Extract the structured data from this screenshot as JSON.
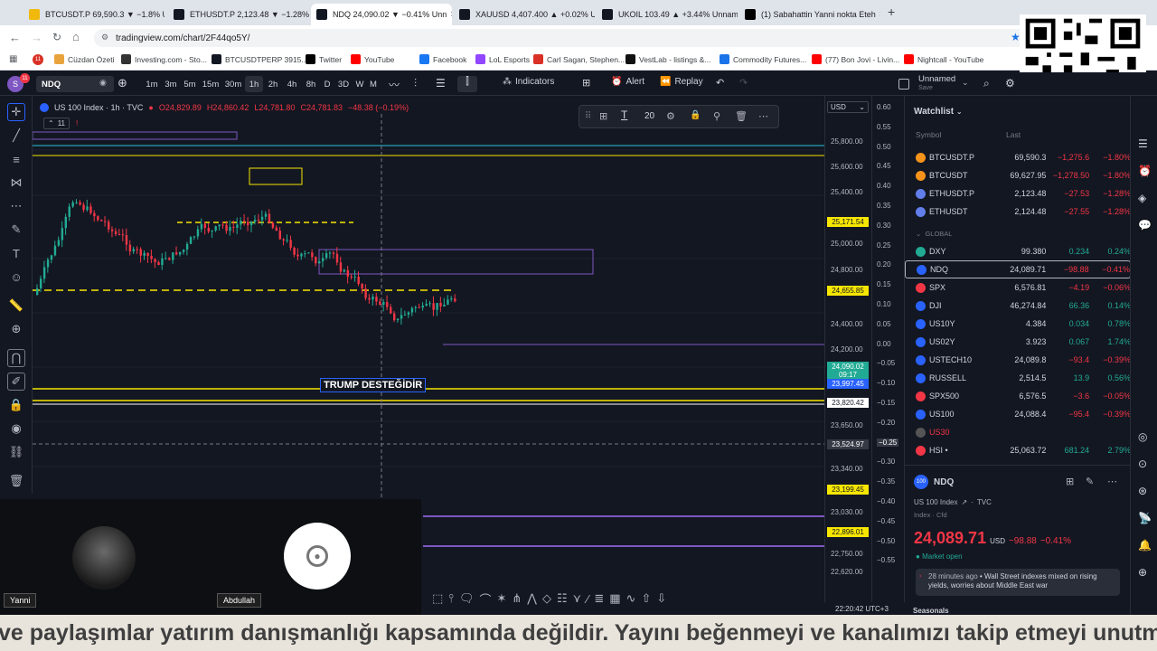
{
  "tabs": [
    {
      "label": "BTCUSDT.P 69,590.3 ▼ −1.8% U",
      "color": "#f0b90b"
    },
    {
      "label": "ETHUSDT.P 2,123.48 ▼ −1.28% U",
      "color": "#131722"
    },
    {
      "label": "NDQ 24,090.02 ▼ −0.41% Unn",
      "color": "#131722",
      "active": true
    },
    {
      "label": "XAUUSD 4,407.400 ▲ +0.02% U",
      "color": "#131722"
    },
    {
      "label": "UKOIL 103.49 ▲ +3.44% Unnam",
      "color": "#131722"
    },
    {
      "label": "(1) Sabahattin Yanni nokta Eteh",
      "color": "#000000"
    }
  ],
  "address": "tradingview.com/chart/2F44qo5Y/",
  "bookmarks": [
    {
      "label": "Cüzdan Özeti",
      "color": "#e8a33d"
    },
    {
      "label": "Investing.com - Sto...",
      "color": "#333333"
    },
    {
      "label": "BTCUSDTPERP 3915...",
      "color": "#131722"
    },
    {
      "label": "Twitter",
      "color": "#000000"
    },
    {
      "label": "YouTube",
      "color": "#ff0000"
    },
    {
      "label": "Facebook",
      "color": "#1877f2"
    },
    {
      "label": "LoL Esports",
      "color": "#9146ff"
    },
    {
      "label": "Carl Sagan, Stephen...",
      "color": "#d93025"
    },
    {
      "label": "VestLab - listings &...",
      "color": "#111111"
    },
    {
      "label": "Commodity Futures...",
      "color": "#1a73e8"
    },
    {
      "label": "(77) Bon Jovi - Livin...",
      "color": "#ff0000"
    },
    {
      "label": "Nightcall - YouTube",
      "color": "#ff0000"
    }
  ],
  "toolbar": {
    "symbol": "NDQ",
    "intervals": [
      "1m",
      "3m",
      "5m",
      "15m",
      "30m",
      "1h",
      "2h",
      "4h",
      "8h",
      "D",
      "3D",
      "W",
      "M"
    ],
    "active_interval": "1h",
    "indicators": "Indicators",
    "alert": "Alert",
    "replay": "Replay",
    "layout_name": "Unnamed",
    "layout_sub": "Save",
    "avatar_letter": "S",
    "notif_count": "11"
  },
  "legend": {
    "title": "US 100 Index · 1h · TVC",
    "o": "O24,829.89",
    "h": "H24,860.42",
    "l": "L24,781.80",
    "c": "C24,781.83",
    "change": "−48.38 (−0.19%)",
    "indicator_count": "11"
  },
  "float_toolbar": {
    "width_value": "20"
  },
  "chart_annotation": "TRUMP DESTEĞİDİR",
  "price_axis": {
    "currency": "USD",
    "labels": [
      "25,800.00",
      "25,600.00",
      "25,400.00",
      "25,000.00",
      "24,800.00",
      "24,400.00",
      "24,200.00",
      "23,650.00",
      "23,340.00",
      "23,030.00",
      "22,750.00",
      "22,620.00"
    ],
    "badges": [
      {
        "text": "25,171.54",
        "bg": "#f7e600"
      },
      {
        "text": "24,655.85",
        "bg": "#f7e600"
      },
      {
        "text": "24,090.02",
        "bg": "#22ab94"
      },
      {
        "text": "09:17",
        "bg": "#22ab94"
      },
      {
        "text": "23,997.45",
        "bg": "#2962ff"
      },
      {
        "text": "23,820.42",
        "bg": "#ffffff"
      },
      {
        "text": "23,524.97",
        "bg": "#363a45"
      },
      {
        "text": "23,199.45",
        "bg": "#f7e600"
      },
      {
        "text": "22,896.01",
        "bg": "#f7e600"
      }
    ]
  },
  "sec_axis": {
    "labels": [
      "0.60",
      "0.55",
      "0.50",
      "0.45",
      "0.40",
      "0.35",
      "0.30",
      "0.25",
      "0.20",
      "0.15",
      "0.10",
      "0.05",
      "0.00",
      "−0.05",
      "−0.10",
      "−0.15",
      "−0.20",
      "−0.25",
      "−0.30",
      "−0.35",
      "−0.40",
      "−0.45",
      "−0.50",
      "−0.55"
    ]
  },
  "watchlist": {
    "title": "Watchlist",
    "col_symbol": "Symbol",
    "col_last": "Last",
    "group_label": "GLOBAL",
    "rows": [
      {
        "sym": "BTCUSDT.P",
        "last": "69,590.3",
        "chg": "−1,275.6",
        "pct": "−1.80%",
        "color": "#f7931a",
        "dir": "neg"
      },
      {
        "sym": "BTCUSDT",
        "last": "69,627.95",
        "chg": "−1,278.50",
        "pct": "−1.80%",
        "color": "#f7931a",
        "dir": "neg"
      },
      {
        "sym": "ETHUSDT.P",
        "last": "2,123.48",
        "chg": "−27.53",
        "pct": "−1.28%",
        "color": "#627eea",
        "dir": "neg"
      },
      {
        "sym": "ETHUSDT",
        "last": "2,124.48",
        "chg": "−27.55",
        "pct": "−1.28%",
        "color": "#627eea",
        "dir": "neg"
      },
      {
        "sym": "DXY",
        "last": "99.380",
        "chg": "0.234",
        "pct": "0.24%",
        "color": "#22ab94",
        "dir": "pos"
      },
      {
        "sym": "NDQ",
        "last": "24,089.71",
        "chg": "−98.88",
        "pct": "−0.41%",
        "color": "#2962ff",
        "dir": "neg"
      },
      {
        "sym": "SPX",
        "last": "6,576.81",
        "chg": "−4.19",
        "pct": "−0.06%",
        "color": "#f23645",
        "dir": "neg"
      },
      {
        "sym": "DJI",
        "last": "46,274.84",
        "chg": "66.36",
        "pct": "0.14%",
        "color": "#2962ff",
        "dir": "pos"
      },
      {
        "sym": "US10Y",
        "last": "4.384",
        "chg": "0.034",
        "pct": "0.78%",
        "color": "#2962ff",
        "dir": "pos"
      },
      {
        "sym": "US02Y",
        "last": "3.923",
        "chg": "0.067",
        "pct": "1.74%",
        "color": "#2962ff",
        "dir": "pos"
      },
      {
        "sym": "USTECH10",
        "last": "24,089.8",
        "chg": "−93.4",
        "pct": "−0.39%",
        "color": "#2962ff",
        "dir": "neg"
      },
      {
        "sym": "RUSSELL",
        "last": "2,514.5",
        "chg": "13.9",
        "pct": "0.56%",
        "color": "#2962ff",
        "dir": "pos"
      },
      {
        "sym": "SPX500",
        "last": "6,576.5",
        "chg": "−3.6",
        "pct": "−0.05%",
        "color": "#f23645",
        "dir": "neg"
      },
      {
        "sym": "US100",
        "last": "24,088.4",
        "chg": "−95.4",
        "pct": "−0.39%",
        "color": "#2962ff",
        "dir": "neg"
      },
      {
        "sym": "US30",
        "last": "",
        "chg": "",
        "pct": "",
        "color": "#555555",
        "dir": "neg"
      },
      {
        "sym": "HSI •",
        "last": "25,063.72",
        "chg": "681.24",
        "pct": "2.79%",
        "color": "#f23645",
        "dir": "pos"
      }
    ]
  },
  "detail": {
    "symbol": "NDQ",
    "name": "US 100 Index",
    "source": "TVC",
    "type": "Index · Cfd",
    "price": "24,089.71",
    "currency": "USD",
    "change": "−98.88",
    "change_pct": "−0.41%",
    "market_status": "Market open",
    "news_time": "28 minutes ago",
    "news_text": "Wall Street indexes mixed on rising yields, worries about Middle East war",
    "seasonals": "Seasonals"
  },
  "cams": {
    "left_name": "Yanni",
    "right_name": "Abdullah"
  },
  "clock": "22:20:42 UTC+3",
  "caption": "ve paylaşımlar yatırım danışmanlığı kapsamında değildir. Yayını beğenmeyi ve kanalımızı takip etmeyi unutma"
}
